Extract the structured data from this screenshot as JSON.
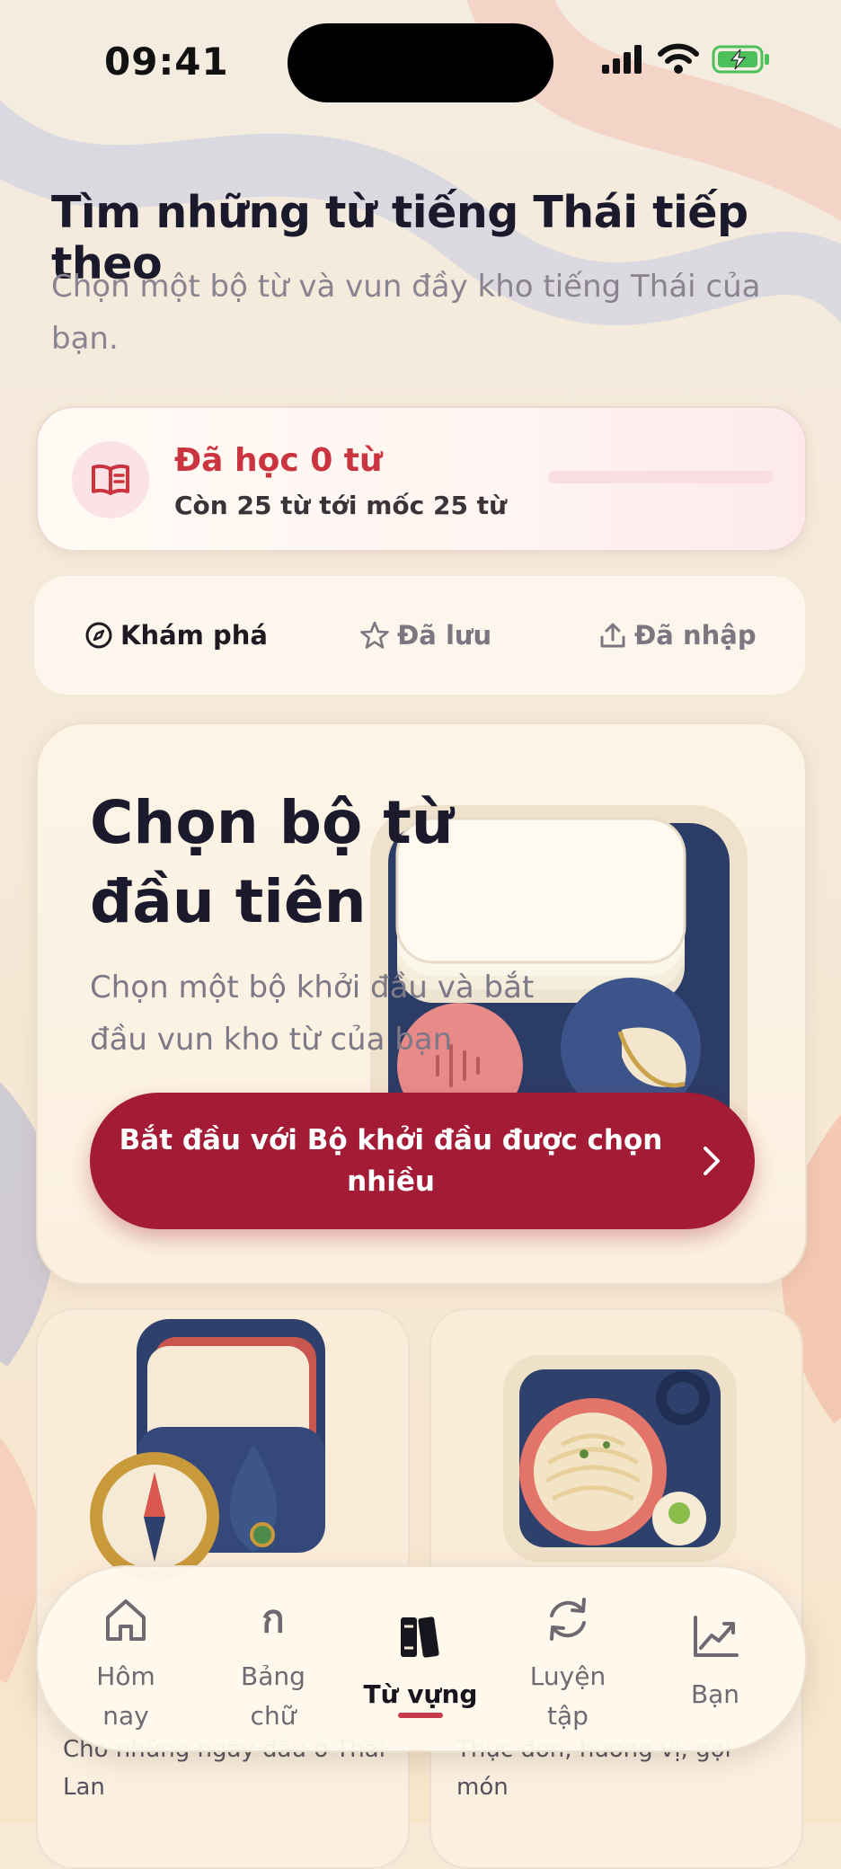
{
  "status_bar": {
    "time": "09:41"
  },
  "header": {
    "title": "Tìm những từ tiếng Thái tiếp theo",
    "subtitle": "Chọn một bộ từ và vun đầy kho tiếng Thái của bạn."
  },
  "progress": {
    "title": "Đã học 0 từ",
    "subtitle": "Còn 25 từ tới mốc 25 từ",
    "learned": 0,
    "goal": 25,
    "accent": "#c9343f"
  },
  "tabs": [
    {
      "label": "Khám phá",
      "icon": "compass-icon",
      "active": true
    },
    {
      "label": "Đã lưu",
      "icon": "star-icon",
      "active": false
    },
    {
      "label": "Đã nhập",
      "icon": "upload-icon",
      "active": false
    }
  ],
  "hero": {
    "title_line1": "Chọn bộ từ",
    "title_line2": "đầu tiên",
    "subtitle": "Chọn một bộ khởi đầu và bắt đầu vun kho từ của bạn",
    "button_label": "Bắt đầu với Bộ khởi đầu được chọn nhiều",
    "button_color": "#a31b35"
  },
  "decks": [
    {
      "text": "Cho những ngày đầu ở Thái Lan",
      "icon": "compass-cards-icon"
    },
    {
      "text": "Thực đơn, hương vị, gọi món",
      "icon": "noodle-bowl-icon"
    }
  ],
  "bottom_nav": [
    {
      "label_line1": "Hôm",
      "label_line2": "nay",
      "icon": "home-icon",
      "active": false
    },
    {
      "label_line1": "Bảng",
      "label_line2": "chữ",
      "icon": "thai-letter-icon",
      "glyph": "ก",
      "active": false
    },
    {
      "label_line1": "Từ vựng",
      "label_line2": "",
      "icon": "books-icon",
      "active": true
    },
    {
      "label_line1": "Luyện",
      "label_line2": "tập",
      "icon": "refresh-icon",
      "active": false
    },
    {
      "label_line1": "Bạn",
      "label_line2": "",
      "icon": "chart-icon",
      "active": false
    }
  ]
}
